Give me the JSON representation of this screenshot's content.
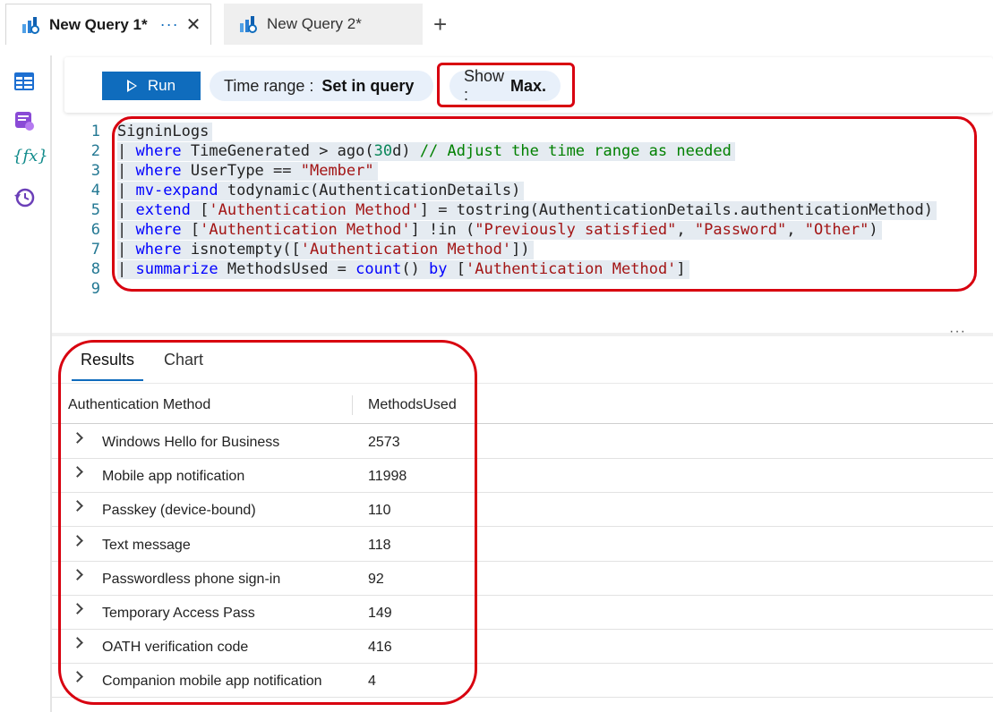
{
  "tabs": [
    {
      "title": "New Query 1*",
      "more": "···",
      "close": "✕",
      "active": true
    },
    {
      "title": "New Query 2*",
      "active": false
    }
  ],
  "new_tab_label": "+",
  "rail": {
    "icons": [
      "table-icon",
      "query-pack-icon",
      "functions-icon",
      "history-icon"
    ],
    "functions_glyph": "{fx}"
  },
  "toolbar": {
    "run_label": "Run",
    "time_range_label": "Time range :",
    "time_range_value": "Set in query",
    "show_label": "Show :",
    "show_value": "Max."
  },
  "editor": {
    "line_numbers": [
      "1",
      "2",
      "3",
      "4",
      "5",
      "6",
      "7",
      "8",
      "9"
    ],
    "lines": [
      "SigninLogs",
      "| where TimeGenerated > ago(30d) // Adjust the time range as needed",
      "| where UserType == \"Member\"",
      "| mv-expand todynamic(AuthenticationDetails)",
      "| extend ['Authentication Method'] = tostring(AuthenticationDetails.authenticationMethod)",
      "| where ['Authentication Method'] !in (\"Previously satisfied\", \"Password\", \"Other\")",
      "| where isnotempty(['Authentication Method'])",
      "| summarize MethodsUsed = count() by ['Authentication Method']",
      ""
    ]
  },
  "splitter_more": "···",
  "results": {
    "tabs": [
      "Results",
      "Chart"
    ],
    "columns": [
      "Authentication Method",
      "MethodsUsed"
    ],
    "rows": [
      {
        "method": "Windows Hello for Business",
        "count": "2573"
      },
      {
        "method": "Mobile app notification",
        "count": "11998"
      },
      {
        "method": "Passkey (device-bound)",
        "count": "110"
      },
      {
        "method": "Text message",
        "count": "118"
      },
      {
        "method": "Passwordless phone sign-in",
        "count": "92"
      },
      {
        "method": "Temporary Access Pass",
        "count": "149"
      },
      {
        "method": "OATH verification code",
        "count": "416"
      },
      {
        "method": "Companion mobile app notification",
        "count": "4"
      }
    ]
  },
  "colors": {
    "accent": "#0f6cbd",
    "highlight": "#d8000f"
  }
}
